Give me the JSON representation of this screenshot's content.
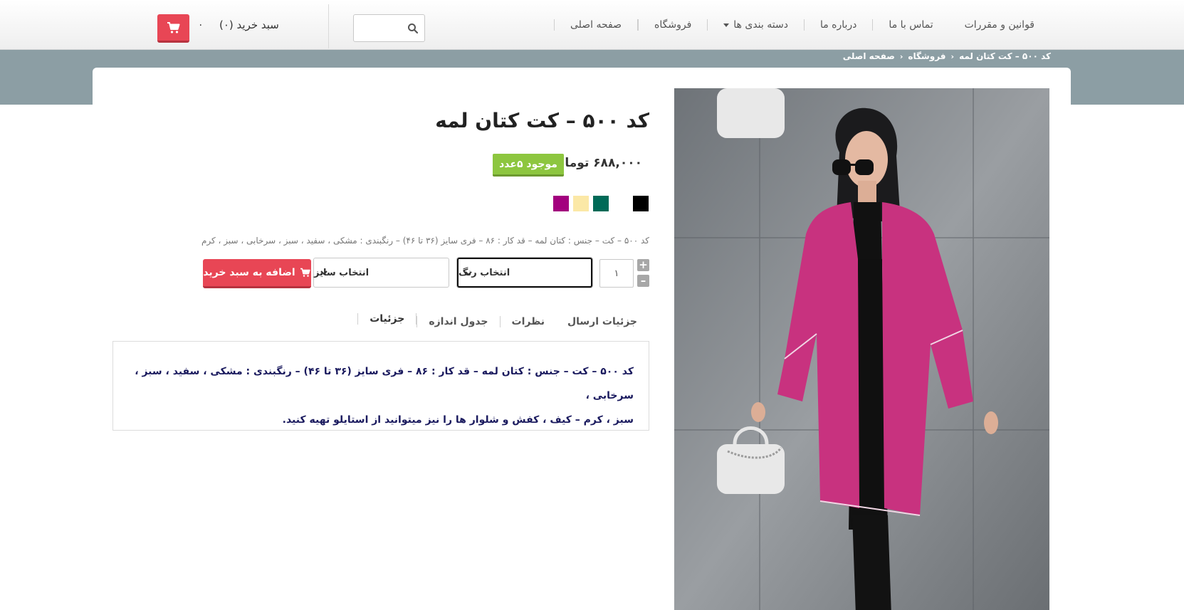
{
  "header": {
    "nav": [
      {
        "label": "صفحه اصلی"
      },
      {
        "label": "فروشگاه"
      },
      {
        "label": "دسته بندی ها",
        "has_dropdown": true
      },
      {
        "label": "درباره ما"
      },
      {
        "label": "تماس با ما"
      },
      {
        "label": "قوانین و مقررات"
      }
    ],
    "search": {
      "value": "",
      "placeholder": ""
    },
    "cart": {
      "label": "سبد خرید (۰)",
      "count": "۰"
    }
  },
  "breadcrumb": [
    "صفحه اصلی",
    "فروشگاه",
    "کد ۵۰۰ – کت کتان لمه"
  ],
  "product": {
    "title": "کد ۵۰۰ – کت کتان لمه",
    "price": "۶۸۸,۰۰۰ تومان",
    "stock": "موجود ۵عدد",
    "swatches": [
      "#000000",
      "#ffffff",
      "#006a57",
      "#fbe8a6",
      "#a3007e"
    ],
    "short_description": "کد ۵۰۰ – کت – جنس : کتان لمه – قد کار : ۸۶ – فری سایز (۳۶ تا ۴۶) – رنگبندی : مشکی ، سفید ، سبز ، سرخابی ، سبز ، کرم",
    "quantity": "۱",
    "color_select": "انتخاب رنگ",
    "size_select": "انتخاب سایز",
    "add_to_cart": "اضافه به سبد خرید",
    "tabs": [
      {
        "label": "جزئیات",
        "active": true
      },
      {
        "label": "جدول اندازه"
      },
      {
        "label": "نظرات"
      },
      {
        "label": "جزئیات ارسال"
      }
    ],
    "details_line1": "کد ۵۰۰ – کت – جنس : کتان لمه – قد کار : ۸۶ – فری سایز (۳۶ تا ۴۶) – رنگبندی : مشکی ، سفید ، سبز ، سرخابی ،",
    "details_line2": "سبز ، کرم – کیف ، کفش و شلوار ها را نیز میتوانید از استایلو تهیه کنید."
  },
  "colors": {
    "accent_red": "#e84655",
    "stock_green": "#8dc63f",
    "banner": "#8c9ea4",
    "tab_underline": "#37b9b3",
    "jacket": "#c8327f"
  }
}
